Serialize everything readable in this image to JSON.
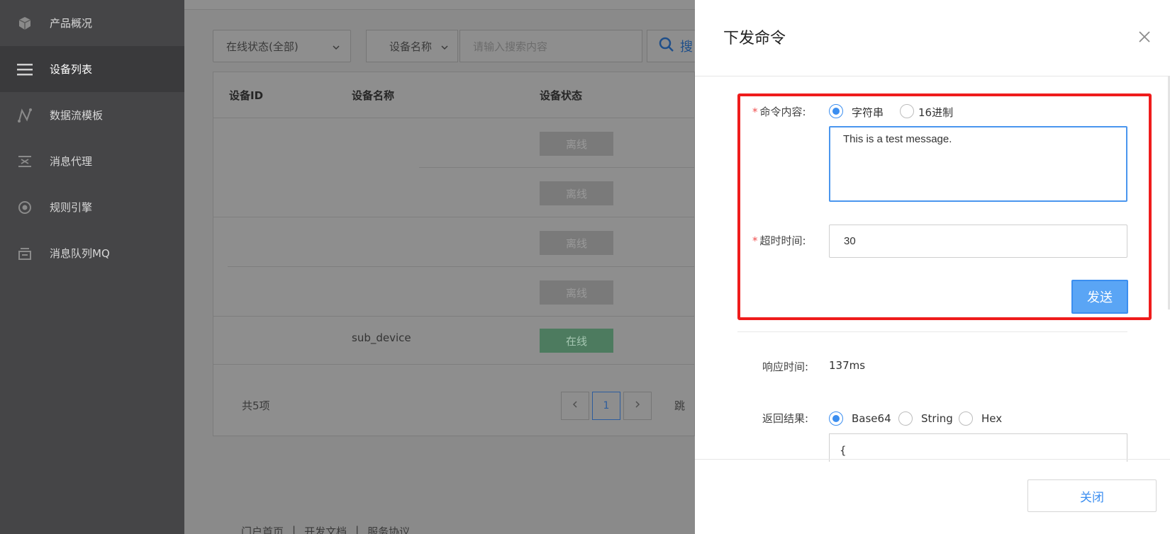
{
  "sidebar": {
    "items": [
      {
        "label": "产品概况",
        "icon": "cube-icon"
      },
      {
        "label": "设备列表",
        "icon": "list-icon"
      },
      {
        "label": "数据流模板",
        "icon": "flow-icon"
      },
      {
        "label": "消息代理",
        "icon": "broker-icon"
      },
      {
        "label": "规则引擎",
        "icon": "rule-icon"
      },
      {
        "label": "消息队列MQ",
        "icon": "queue-icon"
      }
    ]
  },
  "filters": {
    "status_select": "在线状态(全部)",
    "field_select": "设备名称",
    "search_placeholder": "请输入搜索内容",
    "search_button": "搜"
  },
  "table": {
    "headers": [
      "设备ID",
      "设备名称",
      "设备状态"
    ],
    "rows": [
      {
        "id": "",
        "name": "",
        "status": "离线"
      },
      {
        "id": "",
        "name": "",
        "status": "离线"
      },
      {
        "id": "",
        "name": "",
        "status": "离线"
      },
      {
        "id": "",
        "name": "",
        "status": "离线"
      },
      {
        "id": "",
        "name": "sub_device",
        "status": "在线"
      }
    ],
    "total": "共5项",
    "current_page": "1",
    "jump_label": "跳"
  },
  "footer": {
    "links": [
      "门户首页",
      "开发文档",
      "服务协议"
    ],
    "separator": "|"
  },
  "modal": {
    "title": "下发命令",
    "command_label": "命令内容:",
    "format_options": [
      "字符串",
      "16进制"
    ],
    "command_value": "This is a test message.",
    "timeout_label": "超时时间:",
    "timeout_value": "30",
    "send_button": "发送",
    "response_time_label": "响应时间:",
    "response_time_value": "137ms",
    "result_label": "返回结果:",
    "result_options": [
      "Base64",
      "String",
      "Hex"
    ],
    "result_preview": "{",
    "close_button": "关闭",
    "required_mark": "*"
  },
  "colors": {
    "accent": "#3b8ef0",
    "highlight": "#ef1c1c",
    "online": "#4d7b5f",
    "offline": "#7a7a7a"
  }
}
